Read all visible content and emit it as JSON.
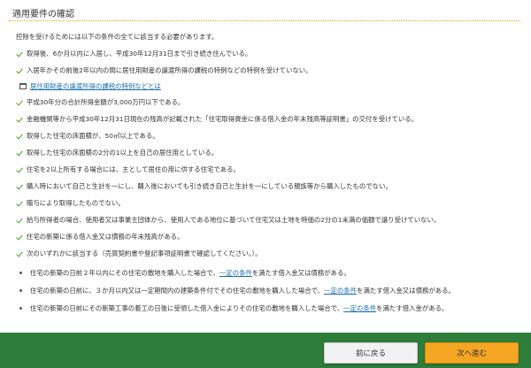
{
  "section": {
    "title": "適用要件の確認",
    "intro": "控除を受けるためには以下の条件の全てに該当する必要があります。"
  },
  "requirements": [
    "取得後、6か月以内に入居し、平成30年12月31日まで引き続き住んでいる。",
    "入居年かその前後2年以内の間に居住用財産の譲渡所得の課税の特例などの特例を受けていない。",
    "平成30年分の合計所得金額が3,000万円以下である。",
    "金融機関等から平成30年12月31日現在の残高が記載された「住宅取得資金に係る借入金の年末残高等証明書」の交付を受けている。",
    "取得した住宅の床面積が、50㎡以上である。",
    "取得した住宅の床面積の2分の1以上を自己の居住用としている。",
    "住宅を2以上所有する場合には、主として居住の用に供する住宅である。",
    "購入時において自己と生計を一にし、購入後においても引き続き自己と生計を一にしている親族等から購入したものでない。",
    "贈与により取得したものでない。",
    "給与所得者の場合、使用者又は事業主団体から、使用人である地位に基づいて住宅又は土地を時価の2分の1未満の価額で譲り受けていない。",
    "住宅の新築に係る借入金又は債務の年末残高がある。",
    "次のいずれかに該当する（売買契約書や登記事項証明書で確認してください。）。"
  ],
  "help_link": "居住用財産の譲渡所得の課税の特例などとは",
  "conditions": [
    {
      "before": "住宅の新築の日前２年以内にその住宅の敷地を購入した場合で、",
      "link": "一定の条件",
      "after": "を満たす借入金又は債務がある。"
    },
    {
      "before": "住宅の新築の日前に、３か月以内又は一定期間内の建築条件付でその住宅の敷地を購入した場合で、",
      "link": "一定の条件",
      "after": "を満たす借入金又は債務がある。"
    },
    {
      "before": "住宅の新築の日前にその新築工事の着工の日後に受領した借入金によりその住宅の敷地を購入した場合で、",
      "link": "一定の条件",
      "after": "を満たす借入金がある。"
    }
  ],
  "buttons": {
    "back": "前に戻る",
    "next": "次へ進む"
  },
  "colors": {
    "accent": "#e6a21e",
    "check": "#4a9b2d",
    "link": "#1a6fb5",
    "footer": "#2e7d3a",
    "next_button": "#f5a623"
  }
}
